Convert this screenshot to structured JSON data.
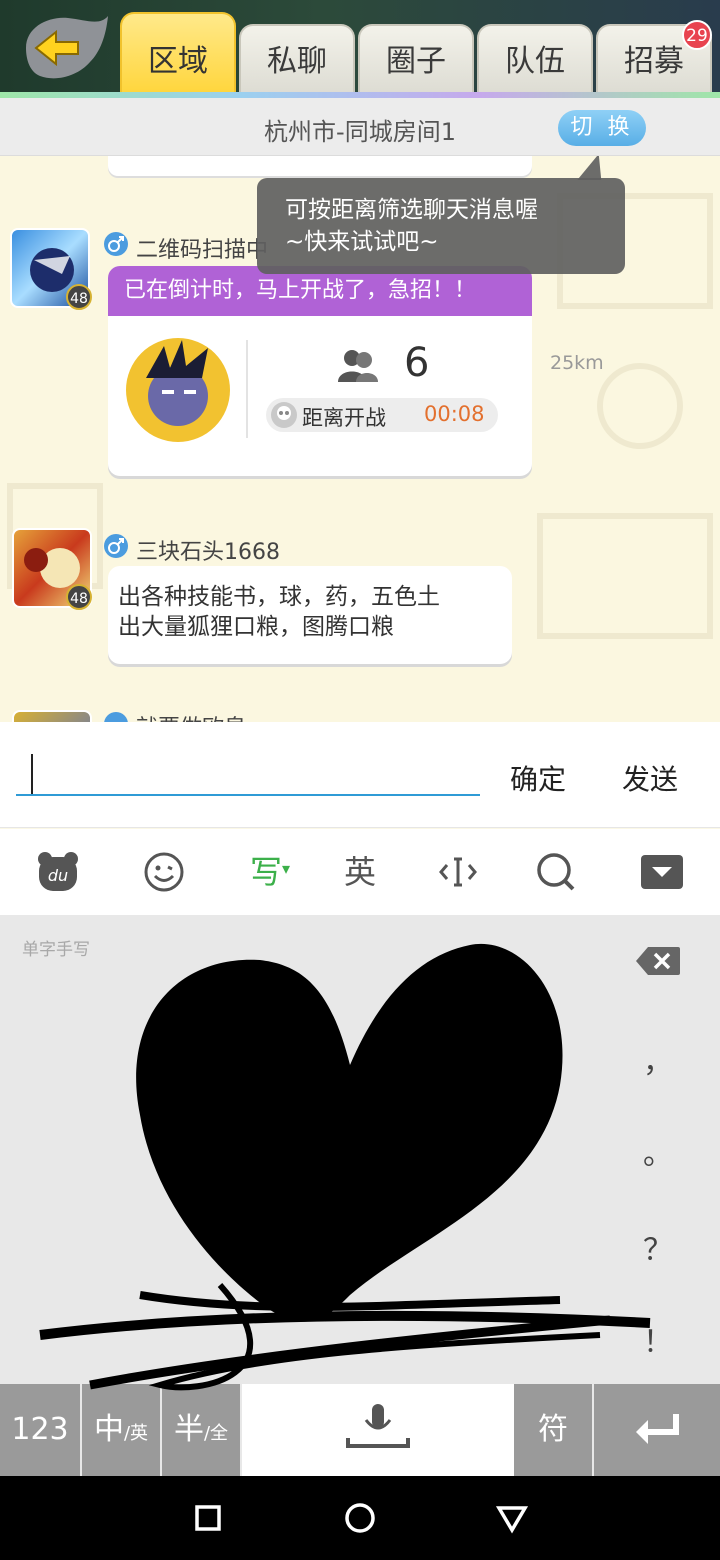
{
  "top_tabs": [
    {
      "label": "区域"
    },
    {
      "label": "私聊"
    },
    {
      "label": "圈子"
    },
    {
      "label": "队伍"
    },
    {
      "label": "招募",
      "badge": "29"
    }
  ],
  "room": {
    "title": "杭州市-同城房间1",
    "switch_label": "切 换"
  },
  "tooltip": {
    "line1": "可按距离筛选聊天消息喔",
    "line2": "~快来试试吧~"
  },
  "messages": [
    {
      "username": "二维码扫描中",
      "level": "48",
      "card_title": "已在倒计时，马上开战了，急招！！",
      "team_count": "6",
      "countdown_label": "距离开战",
      "countdown_time": "00:08",
      "distance": "25km"
    },
    {
      "username": "三块石头1668",
      "level": "48",
      "line1": "出各种技能书，球，药，五色土",
      "line2": "出大量狐狸口粮，图腾口粮"
    },
    {
      "username": "就要做欧皇"
    }
  ],
  "input": {
    "value": "",
    "confirm_label": "确定",
    "send_label": "发送"
  },
  "keyboard": {
    "toolbar": {
      "write_label": "写",
      "english_label": "英"
    },
    "mode_label": "单字手写",
    "punctuation": [
      "，",
      "。",
      "？",
      "！"
    ],
    "keys": {
      "num": "123",
      "cn": "中",
      "cn_sub": "/英",
      "half": "半",
      "half_sub": "/全",
      "symbols": "符"
    }
  },
  "colors": {
    "active_tab": "#ffd53a",
    "card_header": "#b062d6",
    "countdown": "#e3702e",
    "input_underline": "#2f9bd6",
    "write_green": "#3cb04a"
  }
}
